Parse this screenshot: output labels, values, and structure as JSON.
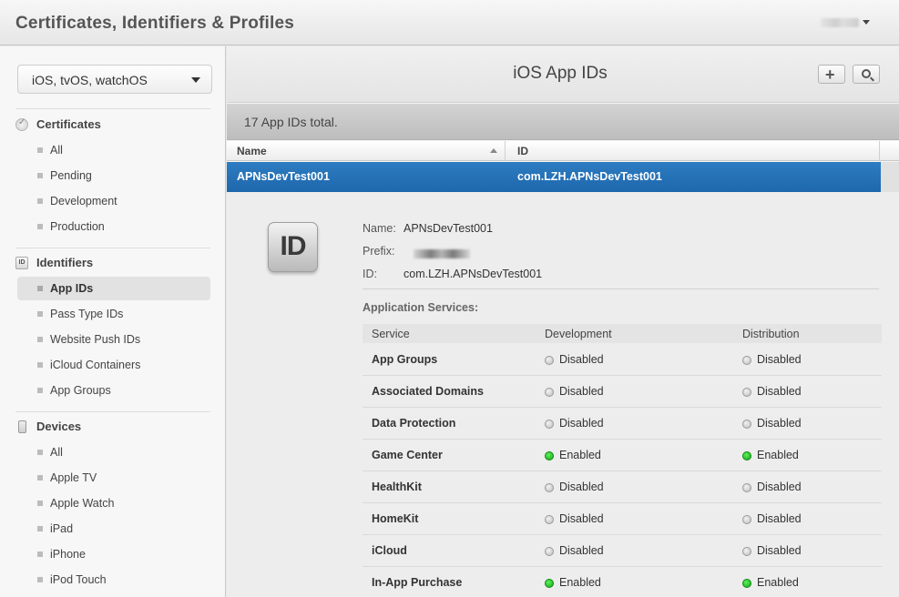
{
  "header": {
    "title": "Certificates, Identifiers & Profiles"
  },
  "sidebar": {
    "platform": "iOS, tvOS, watchOS",
    "sections": [
      {
        "title": "Certificates",
        "icon": "certificate-icon",
        "items": [
          "All",
          "Pending",
          "Development",
          "Production"
        ]
      },
      {
        "title": "Identifiers",
        "icon": "id-badge-icon",
        "items": [
          "App IDs",
          "Pass Type IDs",
          "Website Push IDs",
          "iCloud Containers",
          "App Groups"
        ],
        "active": "App IDs"
      },
      {
        "title": "Devices",
        "icon": "device-icon",
        "items": [
          "All",
          "Apple TV",
          "Apple Watch",
          "iPad",
          "iPhone",
          "iPod Touch"
        ]
      }
    ]
  },
  "main": {
    "title": "iOS App IDs",
    "count_text": "17  App IDs total.",
    "columns": {
      "name": "Name",
      "id": "ID"
    },
    "selected": {
      "name": "APNsDevTest001",
      "id": "com.LZH.APNsDevTest001"
    },
    "detail": {
      "icon_text": "ID",
      "name_label": "Name:",
      "name_value": "APNsDevTest001",
      "prefix_label": "Prefix:",
      "id_label": "ID:",
      "id_value": "com.LZH.APNsDevTest001",
      "services_title": "Application Services:",
      "service_headers": {
        "service": "Service",
        "development": "Development",
        "distribution": "Distribution"
      },
      "services": [
        {
          "name": "App Groups",
          "development": "Disabled",
          "distribution": "Disabled"
        },
        {
          "name": "Associated Domains",
          "development": "Disabled",
          "distribution": "Disabled"
        },
        {
          "name": "Data Protection",
          "development": "Disabled",
          "distribution": "Disabled"
        },
        {
          "name": "Game Center",
          "development": "Enabled",
          "distribution": "Enabled"
        },
        {
          "name": "HealthKit",
          "development": "Disabled",
          "distribution": "Disabled"
        },
        {
          "name": "HomeKit",
          "development": "Disabled",
          "distribution": "Disabled"
        },
        {
          "name": "iCloud",
          "development": "Disabled",
          "distribution": "Disabled"
        },
        {
          "name": "In-App Purchase",
          "development": "Enabled",
          "distribution": "Enabled"
        }
      ]
    }
  },
  "colors": {
    "selection": "#1e67ad",
    "enabled": "#16a616",
    "disabled": "#bdbdbd"
  }
}
